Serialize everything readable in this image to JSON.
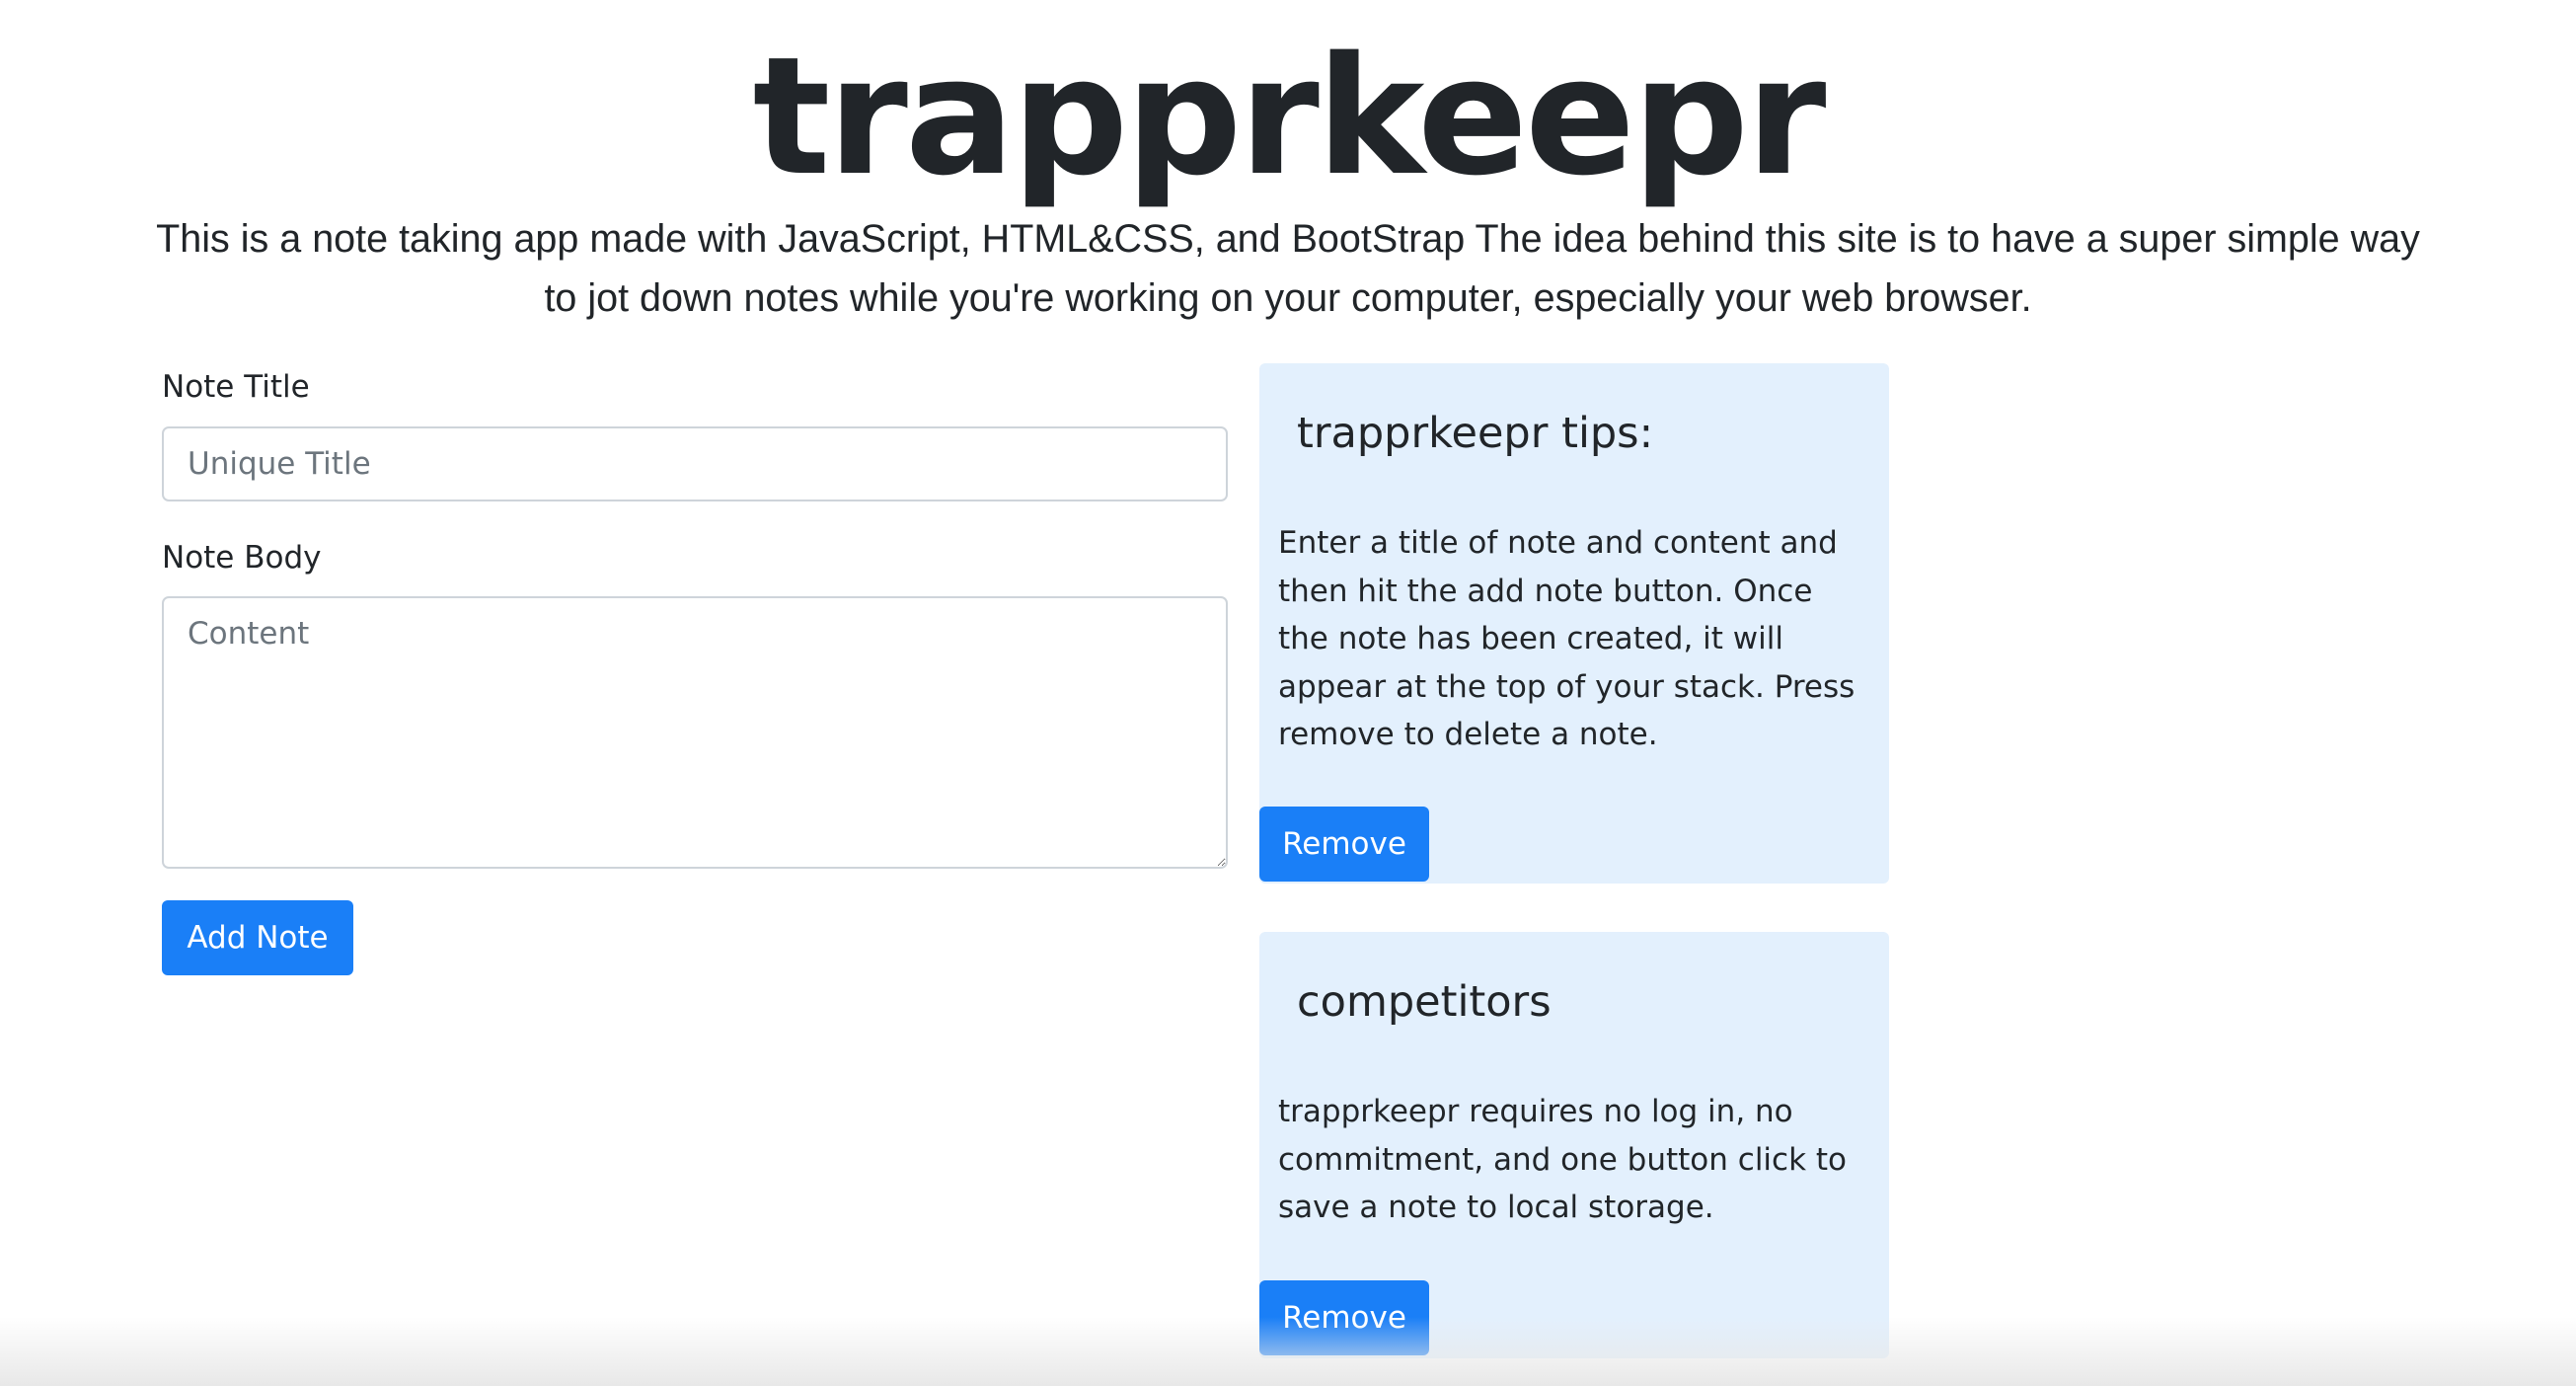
{
  "header": {
    "logo": "trapprkeepr",
    "intro": "This is a note taking app made with JavaScript, HTML&CSS, and BootStrap The idea behind this site is to have a super simple way to jot down notes while you're working on your computer, especially your web browser."
  },
  "form": {
    "title_label": "Note Title",
    "title_placeholder": "Unique Title",
    "title_value": "",
    "body_label": "Note Body",
    "body_placeholder": "Content",
    "body_value": "",
    "add_button": "Add Note"
  },
  "notes": [
    {
      "title": "trapprkeepr tips:",
      "body": "Enter a title of note and content and then hit the add note button. Once the note has been created, it will appear at the top of your stack. Press remove to delete a note.",
      "remove_label": "Remove"
    },
    {
      "title": "competitors",
      "body": "trapprkeepr requires no log in, no commitment, and one button click to save a note to local storage.",
      "remove_label": "Remove"
    }
  ],
  "colors": {
    "accent": "#1a7ff7",
    "card_background": "#e3f0fd",
    "text": "#212529"
  }
}
